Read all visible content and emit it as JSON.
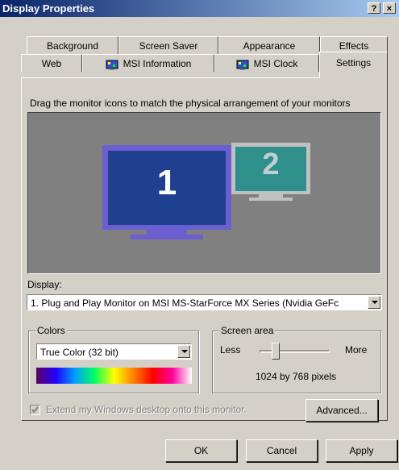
{
  "window": {
    "title": "Display Properties",
    "help": "?",
    "close": "×"
  },
  "tabs_back": [
    "Background",
    "Screen Saver",
    "Appearance",
    "Effects"
  ],
  "tabs_front": [
    "Web",
    "MSI Information",
    "MSI Clock",
    "Settings"
  ],
  "preview": {
    "instruction": "Drag the monitor icons to match the physical arrangement of your monitors",
    "monitor1": "1",
    "monitor2": "2"
  },
  "display": {
    "label": "Display:",
    "value": "1. Plug and Play Monitor on MSI MS-StarForce MX Series (Nvidia GeFc"
  },
  "colors": {
    "label": "Colors",
    "value": "True Color (32 bit)"
  },
  "screen_area": {
    "label": "Screen area",
    "less": "Less",
    "more": "More",
    "value": "1024 by 768 pixels",
    "slider_fraction": 0.2
  },
  "extend": {
    "label": "Extend my Windows desktop onto this monitor.",
    "checked": true,
    "enabled": false
  },
  "buttons": {
    "advanced": "Advanced...",
    "ok": "OK",
    "cancel": "Cancel",
    "apply": "Apply"
  },
  "colors_theme": {
    "titlebar": "#0a246a",
    "monitor1": "#1f3f8f",
    "monitor2": "#2f8f8a",
    "face": "#d4d0c8"
  }
}
